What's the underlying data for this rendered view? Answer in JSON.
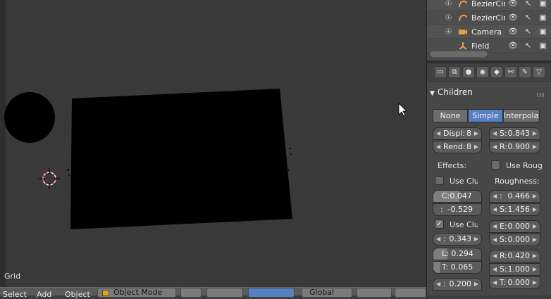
{
  "viewport": {
    "grid_label": "Grid",
    "header": {
      "select": "Select",
      "add": "Add",
      "object": "Object",
      "mode": "Object Mode",
      "orientation": "Global"
    }
  },
  "outliner": {
    "rows": [
      {
        "name": "BezierCircle",
        "icon": "curve-icon"
      },
      {
        "name": "BezierCircle",
        "icon": "curve-icon"
      },
      {
        "name": "Camera",
        "icon": "camera-icon"
      },
      {
        "name": "Field",
        "icon": "force-field-icon"
      }
    ]
  },
  "properties": {
    "tabs": [
      "render-icon",
      "scene-icon",
      "world-icon",
      "object-icon",
      "constraints-icon",
      "modifiers-icon",
      "data-icon",
      "material-icon",
      "particles-icon",
      "physics-icon"
    ],
    "panel_title": "Children",
    "children_mode": {
      "options": [
        "None",
        "Simple",
        "Interpolated"
      ],
      "selected": "Simple"
    },
    "display": {
      "label": "Displ:",
      "value": "8"
    },
    "render": {
      "label": "Rend:",
      "value": "8"
    },
    "size": {
      "label": "S:",
      "value": "0.843"
    },
    "random_size": {
      "label": "R:",
      "value": "0.900"
    },
    "effects_label": "Effects:",
    "use_roughness_curve": "Use Roughness Curve",
    "roughness_label": "Roughness:",
    "use_clump_curve": "Use Clump Curve",
    "clump": {
      "label": "C:",
      "value": "0.047",
      "fill": 0.55
    },
    "shape": {
      "label": ":",
      "value": "-0.529"
    },
    "roughness_1": {
      "label": ":",
      "value": "0.466"
    },
    "roughness_1_size": {
      "label": "S:",
      "value": "1.456"
    },
    "use_clump_noise": "Use Clump Noise",
    "use_clump_noise_checked": true,
    "clump_noise_size": {
      "label": ":",
      "value": "0.343"
    },
    "endpoint": {
      "label": "E:",
      "value": "0.000"
    },
    "endpoint_shape": {
      "label": "S:",
      "value": "0.000"
    },
    "length": {
      "label": "L:",
      "value": "0.294",
      "fill": 0.3
    },
    "threshold": {
      "label": "T:",
      "value": "0.065",
      "fill": 0.15
    },
    "random": {
      "label": "R:",
      "value": "0.420"
    },
    "random_size_2": {
      "label": "S:",
      "value": "1.000"
    },
    "random_threshold": {
      "label": "T:",
      "value": "0.000"
    },
    "twist": {
      "label": ":",
      "value": "0.200"
    }
  }
}
